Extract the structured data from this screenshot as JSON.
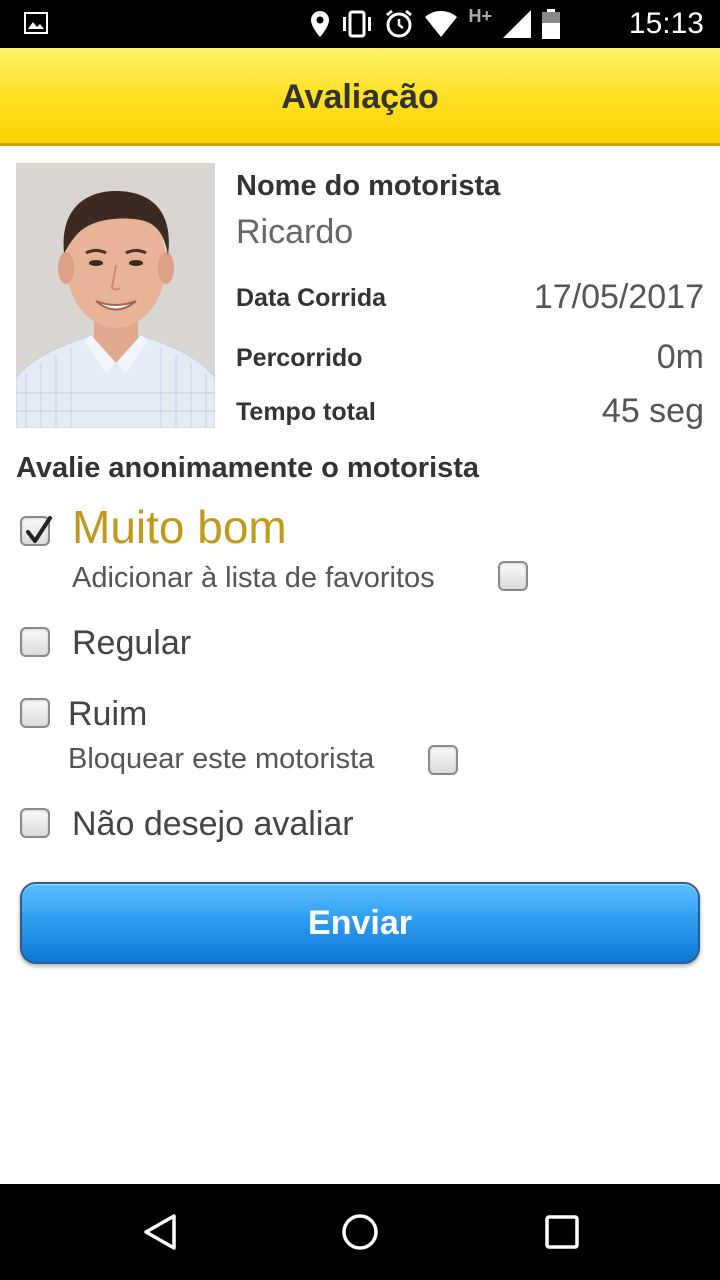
{
  "status_bar": {
    "time": "15:13",
    "network": "H+",
    "icons": [
      "gallery-icon",
      "location-icon",
      "vibrate-icon",
      "alarm-icon",
      "wifi-icon",
      "signal-icon",
      "battery-icon"
    ]
  },
  "header": {
    "title": "Avaliação"
  },
  "driver": {
    "name_label": "Nome do motorista",
    "name": "Ricardo",
    "date_label": "Data Corrida",
    "date": "17/05/2017",
    "distance_label": "Percorrido",
    "distance": "0m",
    "total_time_label": "Tempo total",
    "total_time": "45 seg"
  },
  "rating": {
    "heading": "Avalie anonimamente o motorista",
    "options": [
      {
        "label": "Muito bom",
        "checked": true
      },
      {
        "label": "Adicionar à lista de favoritos",
        "checked": false
      },
      {
        "label": "Regular",
        "checked": false
      },
      {
        "label": "Ruim",
        "checked": false
      },
      {
        "label": "Bloquear este motorista",
        "checked": false
      },
      {
        "label": "Não desejo avaliar",
        "checked": false
      }
    ]
  },
  "actions": {
    "send_label": "Enviar"
  },
  "colors": {
    "header_yellow": "#ffd400",
    "button_blue": "#2f9df0",
    "selected_gold": "#c19a1b"
  }
}
